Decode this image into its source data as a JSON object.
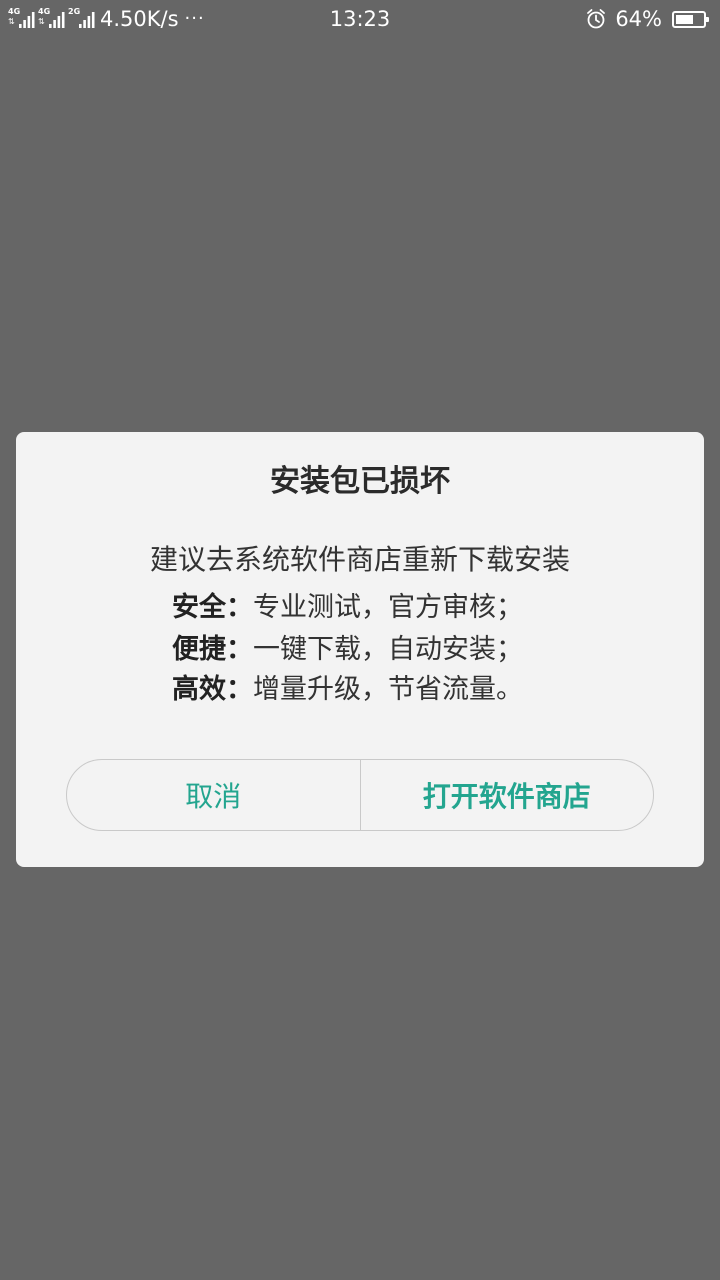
{
  "status_bar": {
    "net1": "4G",
    "net2": "4G",
    "net3": "2G",
    "speed": "4.50K/s",
    "more": "···",
    "time": "13:23",
    "battery_percent": "64%",
    "battery_level": 0.64
  },
  "dialog": {
    "title": "安装包已损坏",
    "subtitle": "建议去系统软件商店重新下载安装",
    "benefits": [
      {
        "label": "安全：",
        "text": "专业测试，官方审核；"
      },
      {
        "label": "便捷：",
        "text": "一键下载，自动安装；"
      },
      {
        "label": "高效：",
        "text": "增量升级，节省流量。"
      }
    ],
    "cancel_label": "取消",
    "open_store_label": "打开软件商店"
  },
  "colors": {
    "overlay": "#666666",
    "dialog_bg": "#f3f3f3",
    "accent": "#23a58f"
  }
}
